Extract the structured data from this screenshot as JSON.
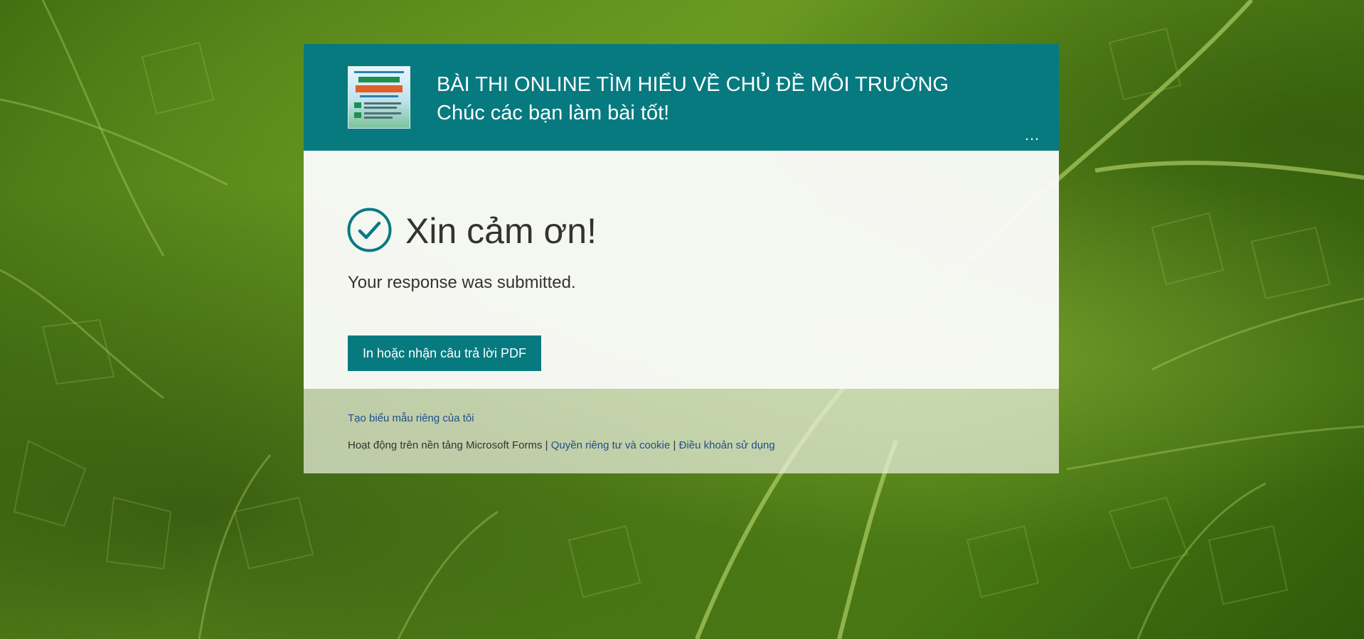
{
  "form": {
    "title": "BÀI THI ONLINE TÌM HIỂU VỀ CHỦ ĐỀ MÔI TRƯỜNG",
    "subtitle": "Chúc các bạn làm bài tốt!",
    "more_label": "…",
    "logo_icon": "contest-poster-image",
    "accent_color": "#077a80"
  },
  "confirmation": {
    "heading": "Xin cảm ơn!",
    "message": "Your response was submitted.",
    "pdf_button_label": "In hoặc nhận câu trả lời PDF",
    "check_icon": "checkmark-circle-icon"
  },
  "footer": {
    "create_own_form_link": "Tạo biểu mẫu riêng của tôi",
    "powered_by": "Hoạt động trên nền tảng Microsoft Forms",
    "separator": "|",
    "privacy_link": "Quyền riêng tư và cookie",
    "terms_link": "Điều khoản sử dụng"
  }
}
